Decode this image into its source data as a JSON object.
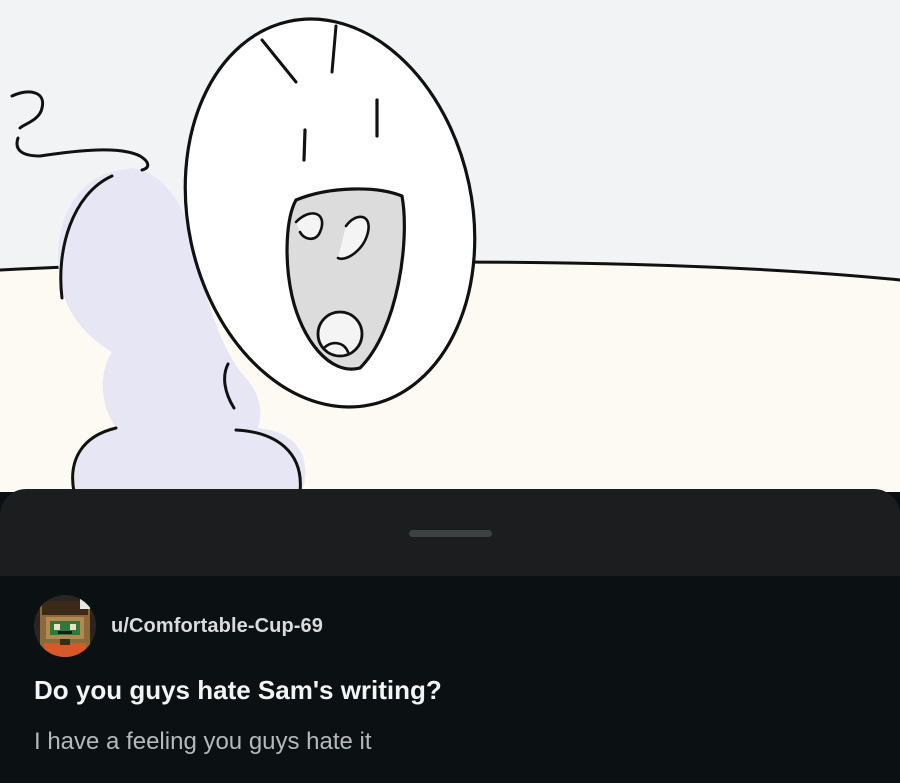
{
  "colors": {
    "page_background": "#0a1012",
    "sheet_background": "#1b1d1e",
    "grabber": "#3e4142",
    "title_text": "#f3f4f4",
    "body_text": "#b6b9ba",
    "username_text": "#d9dcdd",
    "sky": "#f2f3f5",
    "ground": "#fcfaf2",
    "figure_fill": "#e7e6f5"
  },
  "media": {
    "description_icon": "cartoon-angry-character-icon"
  },
  "post": {
    "author": {
      "username": "u/Comfortable-Cup-69",
      "avatar_icon": "pixel-character-avatar-icon"
    },
    "title": "Do you guys hate Sam's writing?",
    "body": "I have a feeling you guys hate it"
  }
}
